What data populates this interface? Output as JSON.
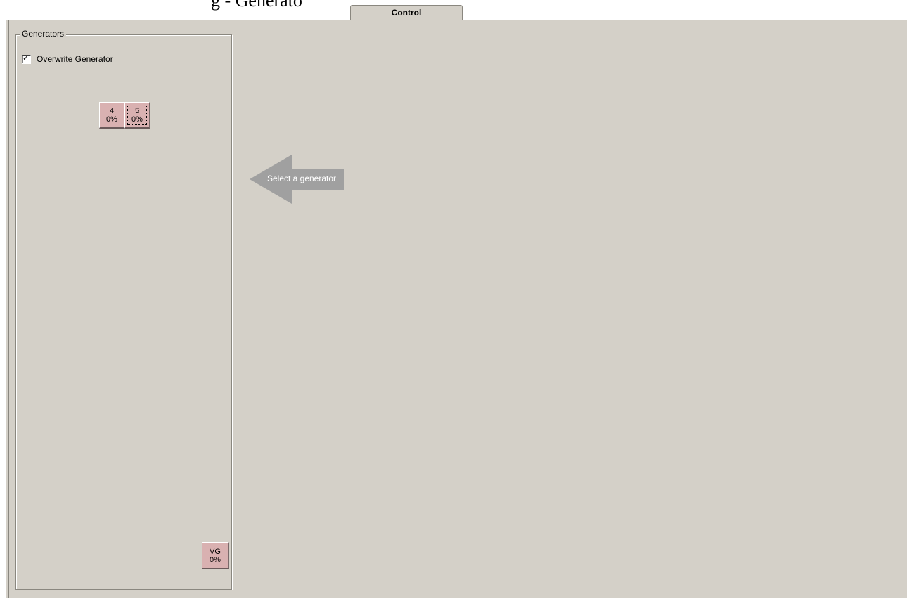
{
  "top_fragment": "g - Generato",
  "tab": {
    "label": "Control"
  },
  "generators_group": {
    "legend": "Generators",
    "overwrite_checkbox": {
      "label": "Overwrite Generator",
      "checked": true
    },
    "buttons": [
      {
        "id": "4",
        "percent": "0%",
        "focused": false
      },
      {
        "id": "5",
        "percent": "0%",
        "focused": true
      },
      {
        "id": "VG",
        "percent": "0%",
        "focused": false
      }
    ]
  },
  "hint": {
    "text": "Select a generator",
    "arrow_color": "#a0a0a0"
  },
  "colors": {
    "panel_bg": "#d4d0c8",
    "generator_button_bg": "#d9b1b1"
  }
}
